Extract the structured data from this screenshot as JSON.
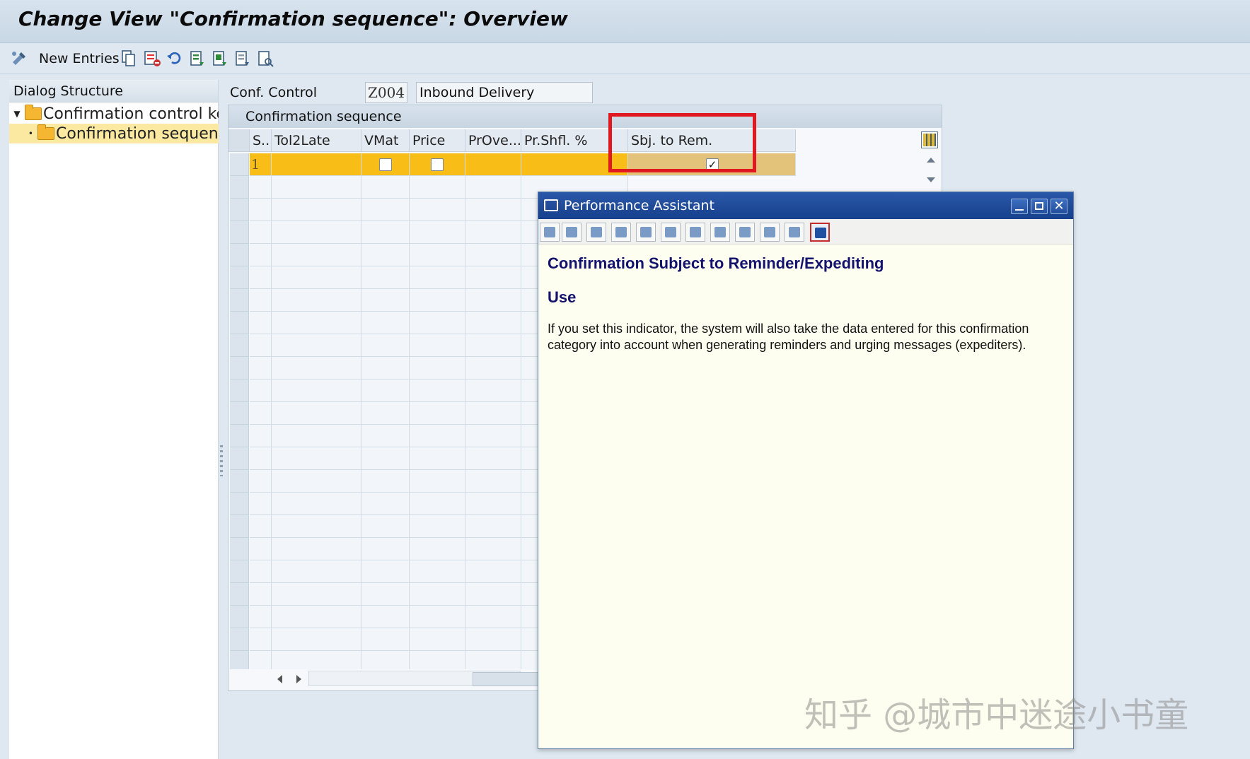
{
  "window": {
    "title": "Change View \"Confirmation sequence\": Overview"
  },
  "toolbar": {
    "new_entries_label": "New Entries"
  },
  "dialog_structure": {
    "header": "Dialog Structure",
    "items": [
      {
        "label": "Confirmation control key"
      },
      {
        "label": "Confirmation sequence"
      }
    ]
  },
  "conf_control": {
    "label": "Conf. Control",
    "value": "Z004",
    "description": "Inbound Delivery"
  },
  "table": {
    "title": "Confirmation sequence",
    "columns": [
      "S..",
      "Tol2Late",
      "VMat",
      "Price",
      "PrOve...",
      "Pr.Shfl. %",
      "Sbj. to Rem."
    ],
    "first_row": {
      "seq": "1",
      "sbj_to_rem": "✓"
    }
  },
  "performance_assistant": {
    "title": "Performance Assistant",
    "heading": "Confirmation Subject to Reminder/Expediting",
    "subheading": "Use",
    "body": "If you set this indicator, the system will also take the data entered for this confirmation category into account when generating reminders and urging messages (expediters)."
  },
  "watermark": "知乎 @城市中迷途小书童",
  "colors": {
    "selected_row": "#f8bd17",
    "highlight": "#e0181f",
    "pa_title": "#1e4b9b",
    "pa_heading": "#13136e"
  }
}
